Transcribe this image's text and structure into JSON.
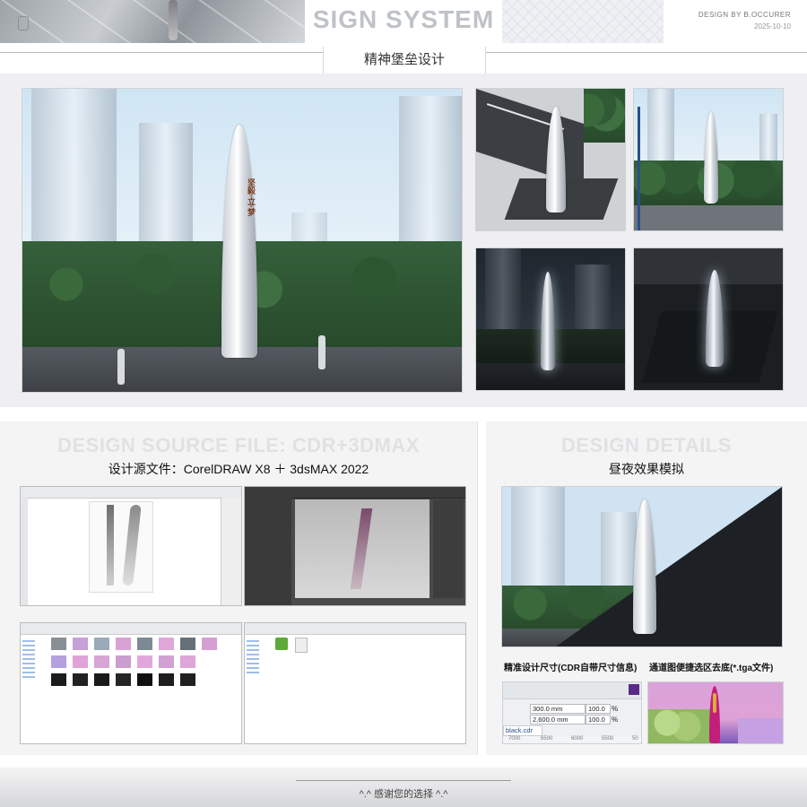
{
  "header": {
    "title": "SIGN SYSTEM",
    "subtitle": "精神堡垒设计",
    "credit": "DESIGN BY B.OCCURER",
    "date": "2025-10-10"
  },
  "gallery": {
    "sign_text": "坚毅·立·梦"
  },
  "source_section": {
    "ghost_title": "DESIGN SOURCE FILE: CDR+3DMAX",
    "subtitle": "设计源文件：CorelDRAW X8  ＋  3dsMAX 2022"
  },
  "details_section": {
    "ghost_title": "DESIGN DETAILS",
    "subtitle": "昼夜效果模拟",
    "caption_left": "精准设计尺寸(CDR自带尺寸信息)",
    "caption_right": "通道图便捷选区去底(*.tga文件)"
  },
  "corel_props": {
    "width_value": "300.0 mm",
    "height_value": "2,600.0 mm",
    "scale_w": "100.0",
    "scale_h": "100.0",
    "percent": "%",
    "file_tab": "black.cdr",
    "ruler": [
      "7000",
      "6500",
      "6000",
      "5500",
      "50"
    ]
  },
  "footer": {
    "text": "^.^  感谢您的选择  ^.^"
  }
}
